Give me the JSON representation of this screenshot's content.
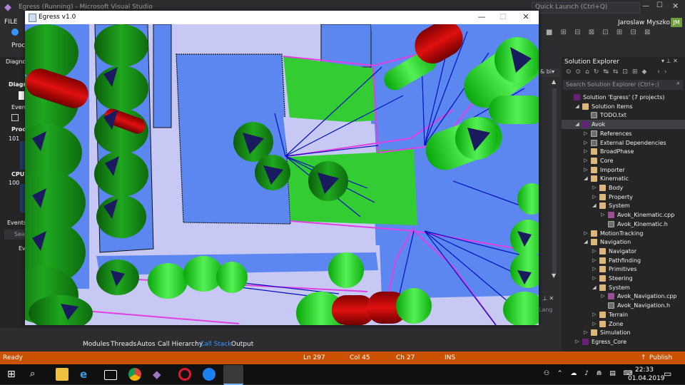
{
  "vs": {
    "title": "Egress (Running) - Microsoft Visual Studio",
    "quick_launch": "Quick Launch (Ctrl+Q)",
    "user": "Jaroslaw Myszko",
    "user_initials": "JM",
    "menu_file": "FILE",
    "toolbar_proc": "Proc"
  },
  "left_panel": {
    "diag_title": "Diagno",
    "diag_sub": "Diagn",
    "events_label": "Even",
    "proc_label": "Proc",
    "val_101": "101",
    "cpu_label": "CPU",
    "val_100": "100",
    "events_tab": "Events",
    "search_stub": "Sea",
    "ev_stub": "Ev"
  },
  "egress_window": {
    "title": "Egress v1.0",
    "minimize": "—",
    "maximize": "☐",
    "close": "✕"
  },
  "bottom_tabs": [
    "Modules",
    "Threads",
    "Autos",
    "Call Hierarchy",
    "Call Stack",
    "Output"
  ],
  "active_tab": "Call Stack",
  "solution_explorer": {
    "title": "Solution Explorer",
    "search_placeholder": "Search Solution Explorer (Ctrl+;)",
    "items": [
      {
        "label": "Solution 'Egress' (7 projects)",
        "depth": 0,
        "icon": "solution",
        "arrow": ""
      },
      {
        "label": "Solution Items",
        "depth": 1,
        "icon": "folder",
        "arrow": "◢"
      },
      {
        "label": "TODO.txt",
        "depth": 2,
        "icon": "file",
        "arrow": ""
      },
      {
        "label": "Avok",
        "depth": 1,
        "icon": "project",
        "arrow": "◢",
        "selected": true
      },
      {
        "label": "References",
        "depth": 2,
        "icon": "ref",
        "arrow": "▷"
      },
      {
        "label": "External Dependencies",
        "depth": 2,
        "icon": "ref",
        "arrow": "▷"
      },
      {
        "label": "BroadPhase",
        "depth": 2,
        "icon": "folder",
        "arrow": "▷"
      },
      {
        "label": "Core",
        "depth": 2,
        "icon": "folder",
        "arrow": "▷"
      },
      {
        "label": "Importer",
        "depth": 2,
        "icon": "folder",
        "arrow": "▷"
      },
      {
        "label": "Kinematic",
        "depth": 2,
        "icon": "folder",
        "arrow": "◢"
      },
      {
        "label": "Body",
        "depth": 3,
        "icon": "folder",
        "arrow": "▷"
      },
      {
        "label": "Property",
        "depth": 3,
        "icon": "folder",
        "arrow": "▷"
      },
      {
        "label": "System",
        "depth": 3,
        "icon": "folder",
        "arrow": "◢"
      },
      {
        "label": "Avok_Kinematic.cpp",
        "depth": 4,
        "icon": "cpp",
        "arrow": "▷"
      },
      {
        "label": "Avok_Kinematic.h",
        "depth": 4,
        "icon": "h",
        "arrow": ""
      },
      {
        "label": "MotionTracking",
        "depth": 2,
        "icon": "folder",
        "arrow": "▷"
      },
      {
        "label": "Navigation",
        "depth": 2,
        "icon": "folder",
        "arrow": "◢"
      },
      {
        "label": "Navigator",
        "depth": 3,
        "icon": "folder",
        "arrow": "▷"
      },
      {
        "label": "Pathfinding",
        "depth": 3,
        "icon": "folder",
        "arrow": "▷"
      },
      {
        "label": "Primitives",
        "depth": 3,
        "icon": "folder",
        "arrow": "▷"
      },
      {
        "label": "Steering",
        "depth": 3,
        "icon": "folder",
        "arrow": "▷"
      },
      {
        "label": "System",
        "depth": 3,
        "icon": "folder",
        "arrow": "◢"
      },
      {
        "label": "Avok_Navigation.cpp",
        "depth": 4,
        "icon": "cpp",
        "arrow": "▷"
      },
      {
        "label": "Avok_Navigation.h",
        "depth": 4,
        "icon": "h",
        "arrow": ""
      },
      {
        "label": "Terrain",
        "depth": 3,
        "icon": "folder",
        "arrow": "▷"
      },
      {
        "label": "Zone",
        "depth": 3,
        "icon": "folder",
        "arrow": "▷"
      },
      {
        "label": "Simulation",
        "depth": 2,
        "icon": "folder",
        "arrow": "▷"
      },
      {
        "label": "Egress_Core",
        "depth": 1,
        "icon": "project",
        "arrow": "▷"
      }
    ]
  },
  "status_bar": {
    "ready": "Ready",
    "ln": "Ln 297",
    "col": "Col 45",
    "ch": "Ch 27",
    "ins": "INS",
    "publish": "Publish"
  },
  "taskbar": {
    "time": "22:33",
    "date": "01.04.2019"
  },
  "colors": {
    "status_orange": "#ca5100",
    "vs_dark": "#2d2d30",
    "scene_blue": "#5d87f0",
    "scene_lavender": "#c8c8f5",
    "tree_green": "#1f8f1f",
    "nav_green": "#33cc33",
    "agent_red": "#c00000",
    "path_magenta": "#e040e0",
    "ray_blue": "#0010c0"
  }
}
